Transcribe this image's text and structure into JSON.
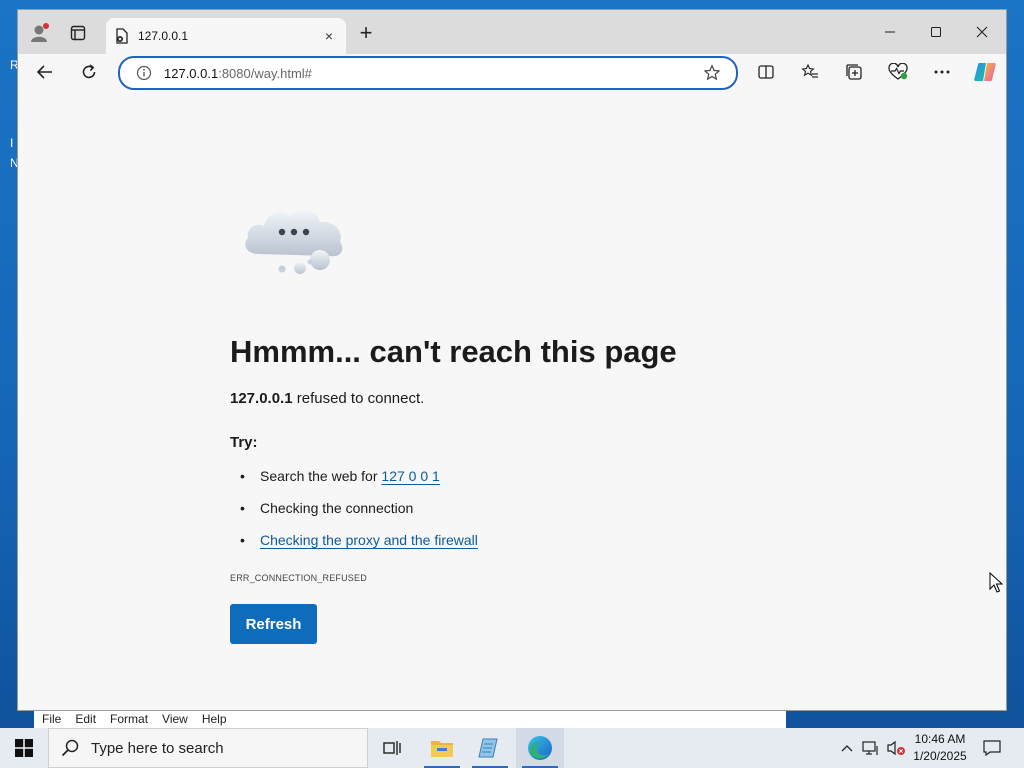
{
  "desktop": {
    "edge_letters": [
      "R",
      "I",
      "N"
    ]
  },
  "notepad": {
    "menu": [
      "File",
      "Edit",
      "Format",
      "View",
      "Help"
    ]
  },
  "browser": {
    "tab": {
      "title": "127.0.0.1",
      "close": "×"
    },
    "new_tab": "+",
    "window_controls": {
      "minimize": "—",
      "maximize": "☐",
      "close": "✕"
    },
    "address": {
      "host": "127.0.0.1",
      "rest": ":8080/way.html#"
    },
    "accent": "#1f64c5"
  },
  "error_page": {
    "title": "Hmmm... can't reach this page",
    "host": "127.0.0.1",
    "subtitle_rest": " refused to connect.",
    "try_label": "Try:",
    "suggestions": [
      {
        "prefix": "Search the web for ",
        "link": "127 0 0 1"
      },
      {
        "prefix": "Checking the connection",
        "link": ""
      },
      {
        "prefix": "",
        "link": "Checking the proxy and the firewall"
      }
    ],
    "bullet": "•",
    "error_code": "ERR_CONNECTION_REFUSED",
    "refresh_label": "Refresh",
    "refresh_color": "#0f6cbd"
  },
  "taskbar": {
    "search_placeholder": "Type here to search",
    "time": "10:46 AM",
    "date": "1/20/2025"
  }
}
